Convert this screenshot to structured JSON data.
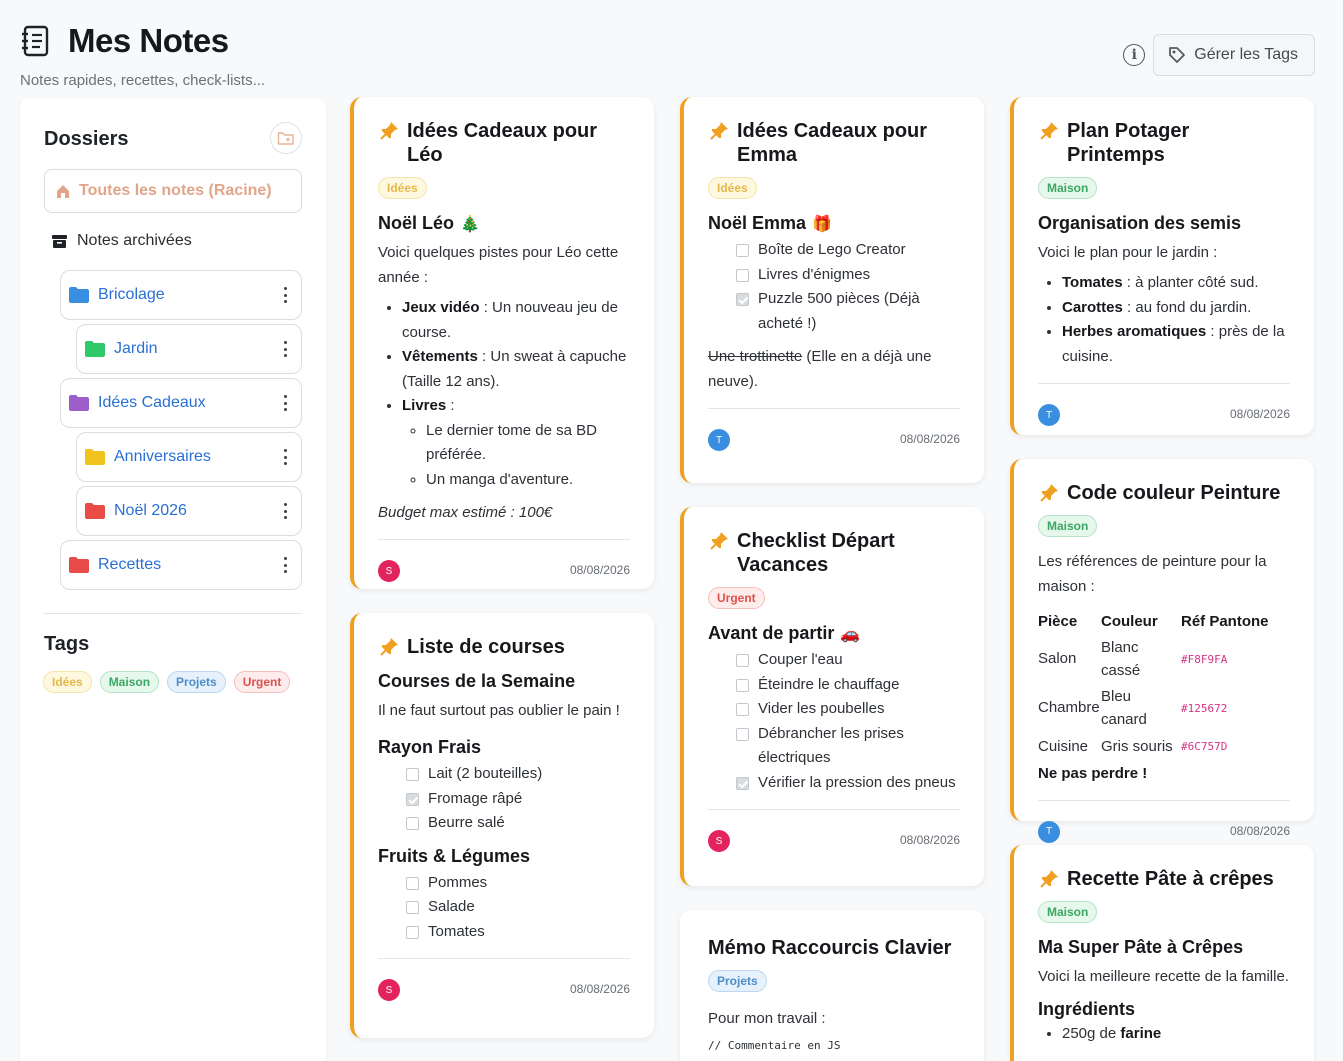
{
  "app": {
    "title": "Mes Notes",
    "subtitle": "Notes rapides, recettes, check-lists...",
    "manage_tags_label": "Gérer les Tags",
    "info_icon": "info-icon"
  },
  "sidebar": {
    "folders_title": "Dossiers",
    "root_label": "Toutes les notes (Racine)",
    "archived_label": "Notes archivées",
    "folders": [
      {
        "label": "Bricolage",
        "color": "#3b8fe0"
      },
      {
        "label": "Jardin",
        "color": "#2fc96b"
      },
      {
        "label": "Idées Cadeaux",
        "color": "#9b5fc9"
      },
      {
        "label": "Anniversaires",
        "color": "#f2c21d"
      },
      {
        "label": "Noël 2026",
        "color": "#e94b47"
      },
      {
        "label": "Recettes",
        "color": "#e94b47"
      }
    ],
    "tags_title": "Tags",
    "tags": [
      {
        "label": "Idées",
        "color": "#e3b94a",
        "bg": "#fff8e0",
        "border": "#f6e3a6"
      },
      {
        "label": "Maison",
        "color": "#3ba764",
        "bg": "#e6f7ec",
        "border": "#b7e3c6"
      },
      {
        "label": "Projets",
        "color": "#4b8ec9",
        "bg": "#e7f1fb",
        "border": "#bcd7ef"
      },
      {
        "label": "Urgent",
        "color": "#d9534f",
        "bg": "#fdeceb",
        "border": "#f3c0be"
      }
    ]
  },
  "notes": {
    "leo": {
      "title": "Idées Cadeaux pour Léo",
      "tag": "Idées",
      "heading": "Noël Léo",
      "heading_emoji": "🎄",
      "intro": "Voici quelques pistes pour Léo cette année :",
      "items": [
        {
          "bold": "Jeux vidéo",
          "text": " : Un nouveau jeu de course."
        },
        {
          "bold": "Vêtements",
          "text": " : Un sweat à capuche (Taille 12 ans)."
        },
        {
          "bold": "Livres",
          "text": " :"
        }
      ],
      "sub_items": [
        "Le dernier tome de sa BD préférée.",
        "Un manga d'aventure."
      ],
      "budget": "Budget max estimé : 100€",
      "avatar": "S",
      "date": "08/08/2026"
    },
    "courses": {
      "title": "Liste de courses",
      "heading": "Courses de la Semaine",
      "intro": "Il ne faut surtout pas oublier le pain !",
      "section1": "Rayon Frais",
      "section1_items": [
        {
          "label": "Lait (2 bouteilles)",
          "checked": false
        },
        {
          "label": "Fromage râpé",
          "checked": true
        },
        {
          "label": "Beurre salé",
          "checked": false
        }
      ],
      "section2": "Fruits & Légumes",
      "section2_items": [
        {
          "label": "Pommes",
          "checked": false
        },
        {
          "label": "Salade",
          "checked": false
        },
        {
          "label": "Tomates",
          "checked": false
        }
      ],
      "avatar": "S",
      "date": "08/08/2026"
    },
    "emma": {
      "title": "Idées Cadeaux pour Emma",
      "tag": "Idées",
      "heading": "Noël Emma",
      "heading_emoji": "🎁",
      "items": [
        {
          "label": "Boîte de Lego Creator",
          "checked": false
        },
        {
          "label": "Livres d'énigmes",
          "checked": false
        },
        {
          "label": "Puzzle 500 pièces (Déjà acheté !)",
          "checked": true
        }
      ],
      "strike_text": "Une trottinette",
      "after_strike": " (Elle en a déjà une neuve).",
      "avatar": "T",
      "date": "08/08/2026"
    },
    "vacances": {
      "title": "Checklist Départ Vacances",
      "tag": "Urgent",
      "heading": "Avant de partir",
      "heading_emoji": "🚗",
      "items": [
        {
          "label": "Couper l'eau",
          "checked": false
        },
        {
          "label": "Éteindre le chauffage",
          "checked": false
        },
        {
          "label": "Vider les poubelles",
          "checked": false
        },
        {
          "label": "Débrancher les prises électriques",
          "checked": false
        },
        {
          "label": "Vérifier la pression des pneus",
          "checked": true
        }
      ],
      "avatar": "S",
      "date": "08/08/2026"
    },
    "memo": {
      "title": "Mémo Raccourcis Clavier",
      "tag": "Projets",
      "intro": "Pour mon travail :",
      "code": "// Commentaire en JS"
    },
    "potager": {
      "title": "Plan Potager Printemps",
      "tag": "Maison",
      "heading": "Organisation des semis",
      "intro": "Voici le plan pour le jardin :",
      "items": [
        {
          "bold": "Tomates",
          "text": " : à planter côté sud."
        },
        {
          "bold": "Carottes",
          "text": " : au fond du jardin."
        },
        {
          "bold": "Herbes aromatiques",
          "text": " : près de la cuisine."
        }
      ],
      "avatar": "T",
      "date": "08/08/2026"
    },
    "peinture": {
      "title": "Code couleur Peinture",
      "tag": "Maison",
      "intro": "Les références de peinture pour la maison :",
      "headers": [
        "Pièce",
        "Couleur",
        "Réf Pantone"
      ],
      "rows": [
        [
          "Salon",
          "Blanc cassé",
          "#F8F9FA"
        ],
        [
          "Chambre",
          "Bleu canard",
          "#125672"
        ],
        [
          "Cuisine",
          "Gris souris",
          "#6C757D"
        ]
      ],
      "footer": "Ne pas perdre !",
      "avatar": "T",
      "date": "08/08/2026"
    },
    "crepes": {
      "title": "Recette Pâte à crêpes",
      "tag": "Maison",
      "heading": "Ma Super Pâte à Crêpes",
      "intro": "Voici la meilleure recette de la famille.",
      "section": "Ingrédients",
      "first_item_text": "250g de ",
      "first_item_bold": "farine"
    }
  },
  "avatar_colors": {
    "S": "#e3245c",
    "T": "#3a8ee0"
  }
}
